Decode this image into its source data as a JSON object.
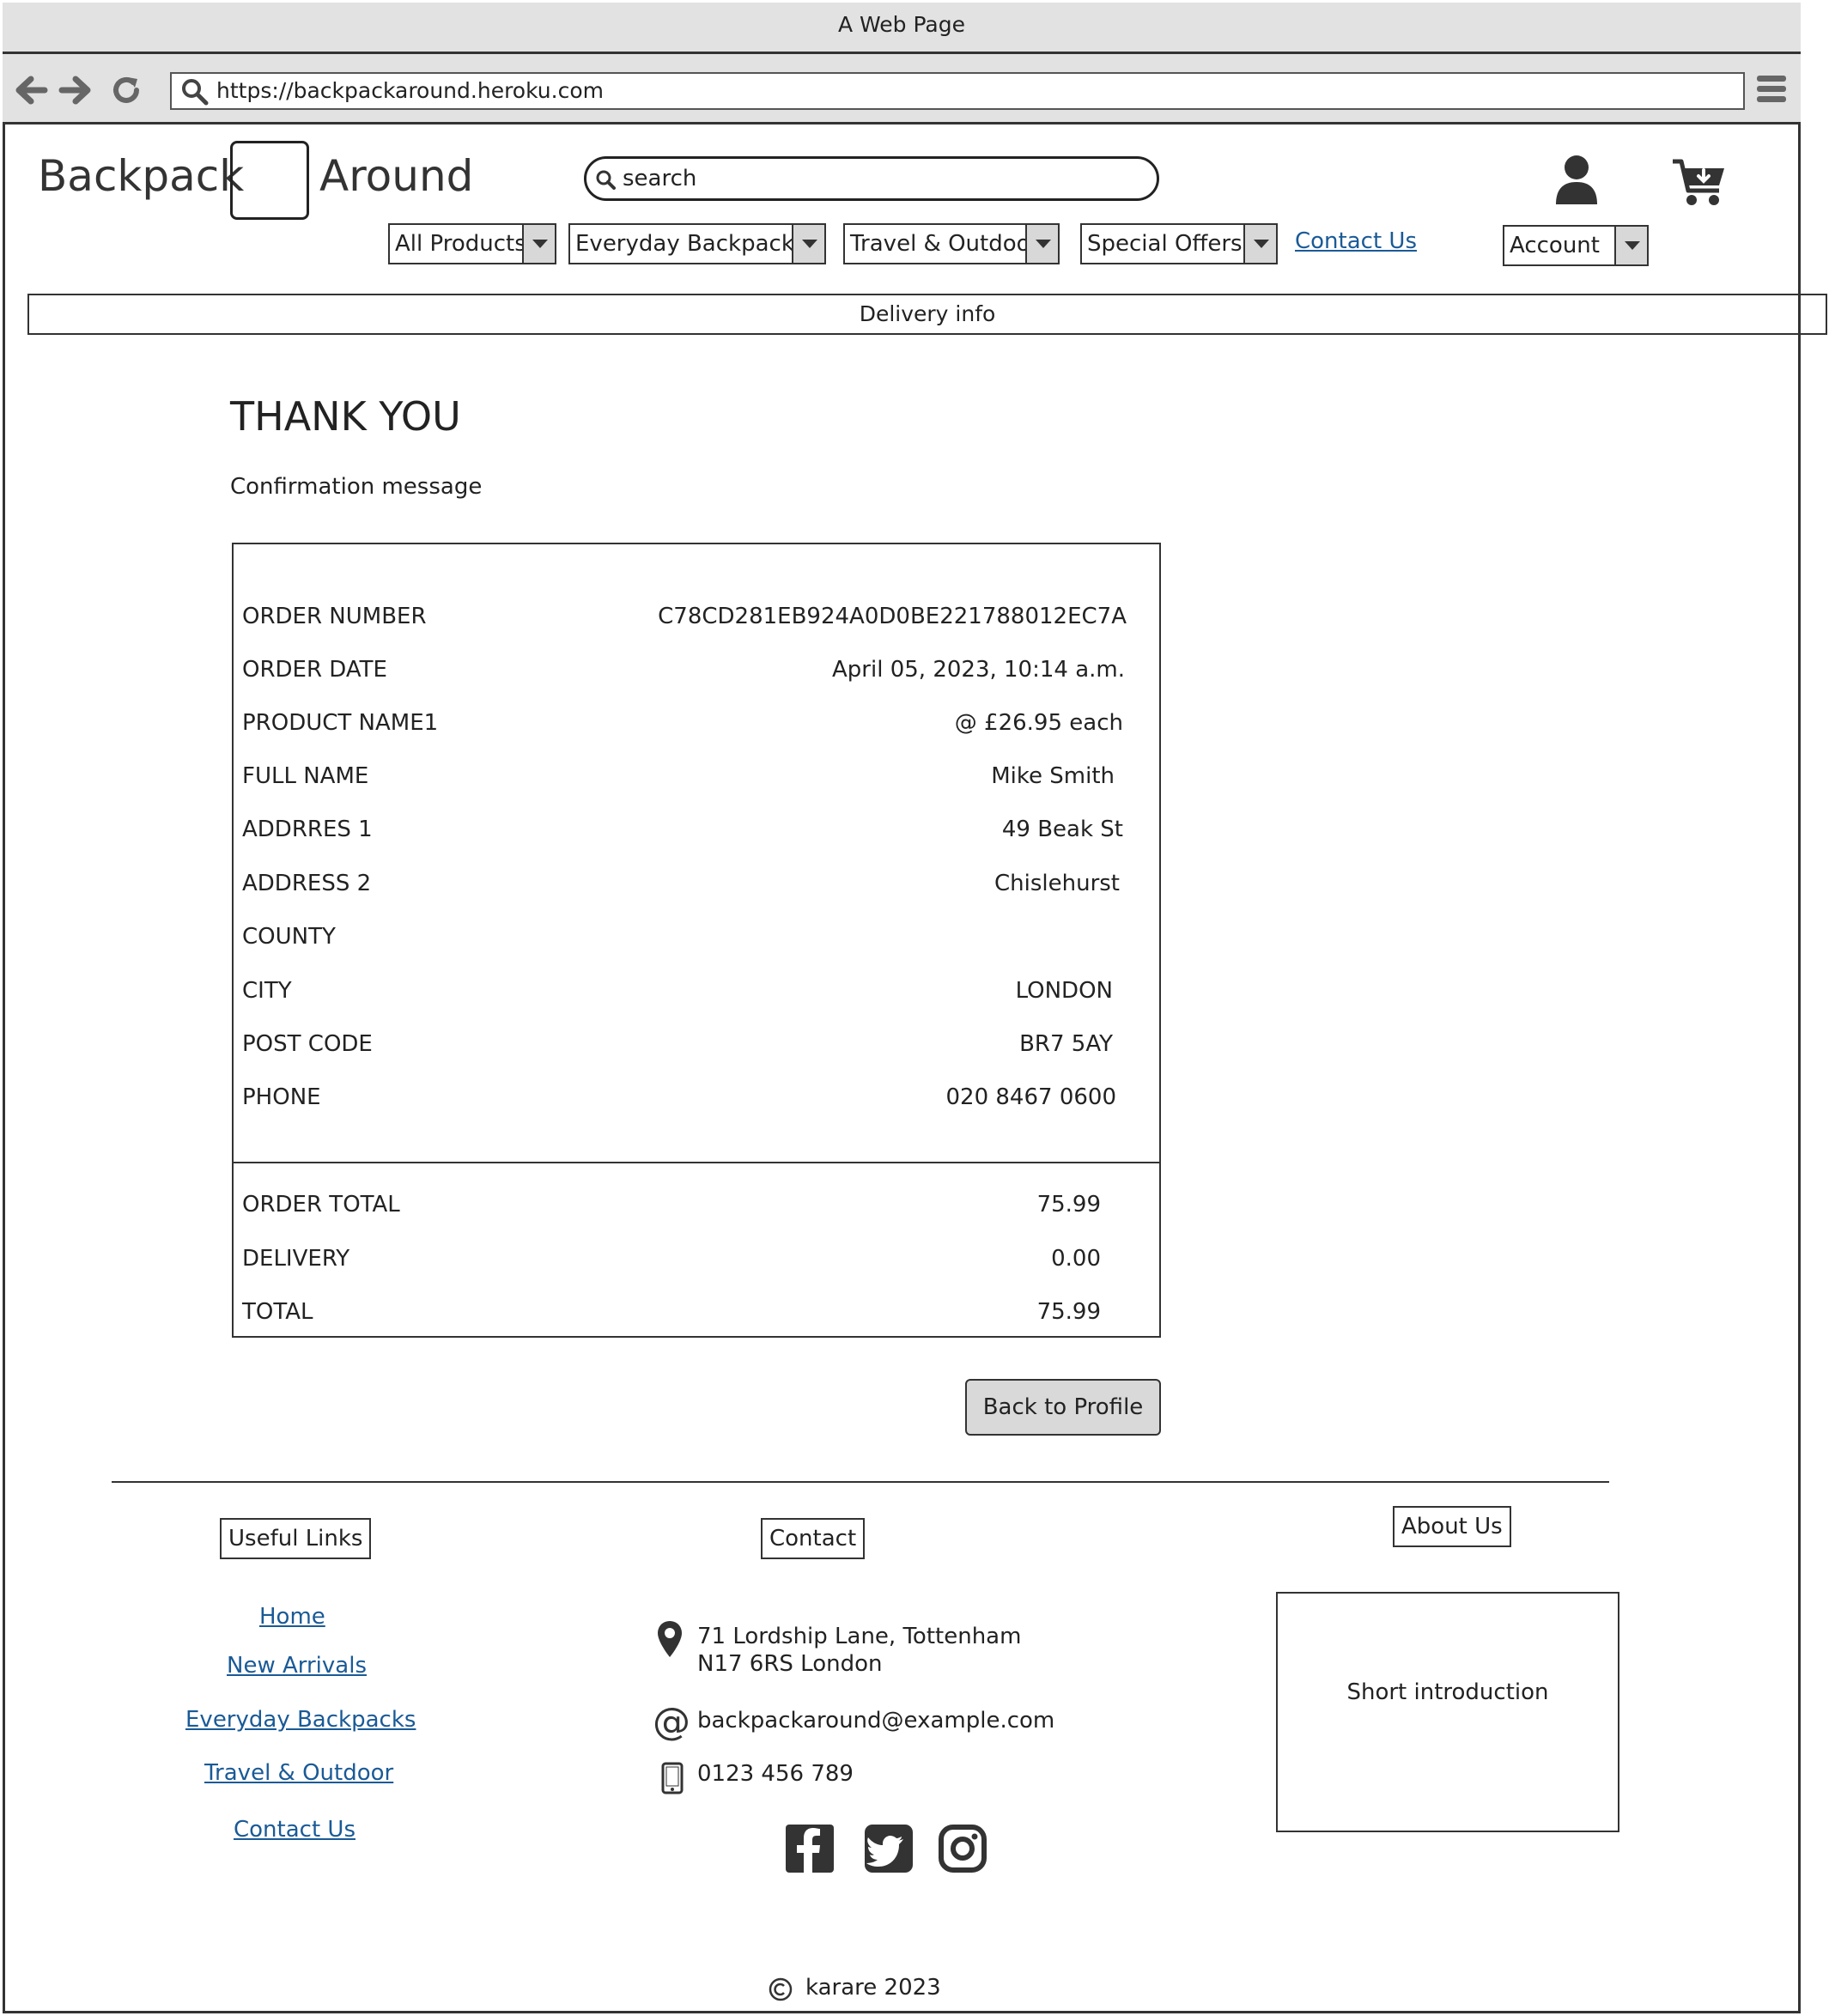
{
  "browser": {
    "title": "A Web Page",
    "url": "https://backpackaround.heroku.com"
  },
  "header": {
    "logo_left": "Backpack",
    "logo_right": "Around",
    "search_placeholder": "search",
    "nav": {
      "all_products": "All Products",
      "everyday_backpacks": "Everyday Backpacks",
      "travel_outdoor": "Travel & Outdoor",
      "special_offers": "Special Offers",
      "contact_us": "Contact Us",
      "account": "Account"
    },
    "delivery_banner": "Delivery info"
  },
  "main": {
    "title": "THANK YOU",
    "confirmation": "Confirmation message",
    "order_details": [
      {
        "label": "ORDER NUMBER",
        "value": "C78CD281EB924A0D0BE221788012EC7A"
      },
      {
        "label": "ORDER DATE",
        "value": "April 05, 2023, 10:14 a.m."
      },
      {
        "label": "PRODUCT NAME1",
        "value": "@ £26.95 each"
      },
      {
        "label": "FULL NAME",
        "value": "Mike Smith"
      },
      {
        "label": "ADDRRES 1",
        "value": "49 Beak St"
      },
      {
        "label": "ADDRESS 2",
        "value": "Chislehurst"
      },
      {
        "label": "COUNTY",
        "value": ""
      },
      {
        "label": "CITY",
        "value": "LONDON"
      },
      {
        "label": "POST CODE",
        "value": "BR7 5AY"
      },
      {
        "label": "PHONE",
        "value": "020 8467 0600"
      }
    ],
    "totals": [
      {
        "label": "ORDER TOTAL",
        "value": "75.99"
      },
      {
        "label": "DELIVERY",
        "value": "0.00"
      },
      {
        "label": "TOTAL",
        "value": "75.99"
      }
    ],
    "back_button": "Back to Profile"
  },
  "footer": {
    "useful_links_heading": "Useful Links",
    "useful_links": [
      "Home",
      "New Arrivals",
      "Everyday Backpacks",
      "Travel & Outdoor",
      "Contact Us"
    ],
    "contact_heading": "Contact",
    "address_line1": "71 Lordship Lane, Tottenham",
    "address_line2": "N17 6RS London",
    "email": "backpackaround@example.com",
    "phone": "0123 456 789",
    "about_heading": "About Us",
    "about_text": "Short introduction",
    "copyright": "karare 2023"
  }
}
